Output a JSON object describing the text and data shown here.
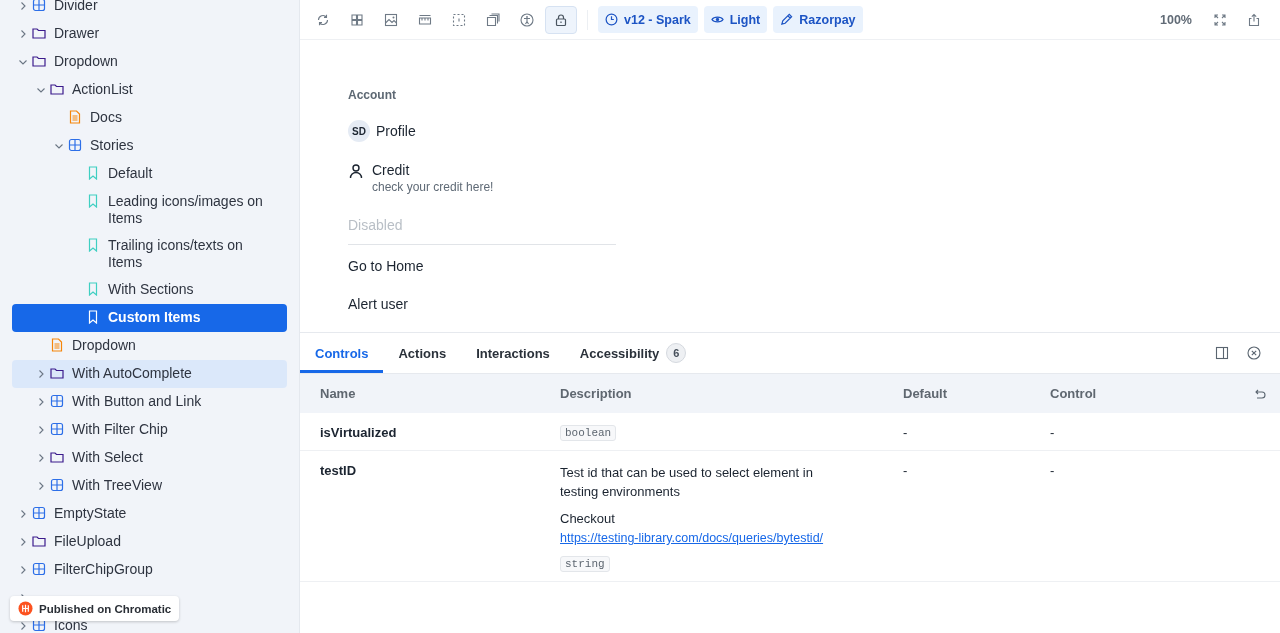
{
  "sidebar": {
    "tree": [
      {
        "kind": "component",
        "label": "Divider",
        "expanded": false,
        "selected": false,
        "hovered": false
      },
      {
        "kind": "folder",
        "label": "Drawer",
        "expanded": false,
        "selected": false,
        "hovered": false
      },
      {
        "kind": "folder",
        "label": "Dropdown",
        "expanded": true,
        "selected": false,
        "hovered": false,
        "children": [
          {
            "kind": "folder",
            "label": "ActionList",
            "expanded": true,
            "selected": false,
            "hovered": false,
            "children": [
              {
                "kind": "docs",
                "label": "Docs",
                "selected": false,
                "hovered": false
              },
              {
                "kind": "component",
                "label": "Stories",
                "expanded": true,
                "selected": false,
                "hovered": false,
                "children": [
                  {
                    "kind": "story",
                    "label": "Default",
                    "selected": false,
                    "hovered": false
                  },
                  {
                    "kind": "story",
                    "label": "Leading icons/images on Items",
                    "selected": false,
                    "hovered": false
                  },
                  {
                    "kind": "story",
                    "label": "Trailing icons/texts on Items",
                    "selected": false,
                    "hovered": false
                  },
                  {
                    "kind": "story",
                    "label": "With Sections",
                    "selected": false,
                    "hovered": false
                  },
                  {
                    "kind": "story",
                    "label": "Custom Items",
                    "selected": true,
                    "hovered": false
                  }
                ]
              }
            ]
          },
          {
            "kind": "docs",
            "label": "Dropdown",
            "selected": false,
            "hovered": false
          },
          {
            "kind": "folder",
            "label": "With AutoComplete",
            "expanded": false,
            "selected": false,
            "hovered": true
          },
          {
            "kind": "component",
            "label": "With Button and Link",
            "expanded": false,
            "selected": false,
            "hovered": false
          },
          {
            "kind": "component",
            "label": "With Filter Chip",
            "expanded": false,
            "selected": false,
            "hovered": false
          },
          {
            "kind": "folder",
            "label": "With Select",
            "expanded": false,
            "selected": false,
            "hovered": false
          },
          {
            "kind": "component",
            "label": "With TreeView",
            "expanded": false,
            "selected": false,
            "hovered": false
          }
        ]
      },
      {
        "kind": "component",
        "label": "EmptyState",
        "expanded": false,
        "selected": false,
        "hovered": false
      },
      {
        "kind": "folder",
        "label": "FileUpload",
        "expanded": false,
        "selected": false,
        "hovered": false
      },
      {
        "kind": "component",
        "label": "FilterChipGroup",
        "expanded": false,
        "selected": false,
        "hovered": false
      },
      {
        "expanded": false,
        "selected": false,
        "hovered": false
      },
      {
        "kind": "component",
        "label": "Icons",
        "expanded": false,
        "selected": false,
        "hovered": false
      }
    ],
    "publish_badge": {
      "label": "Published on Chromatic"
    }
  },
  "toolbar": {
    "tools": [
      {
        "kind": "reload",
        "selected": false
      },
      {
        "kind": "grid",
        "selected": false
      },
      {
        "kind": "image",
        "selected": false
      },
      {
        "kind": "ruler",
        "selected": false
      },
      {
        "kind": "outline",
        "selected": false
      },
      {
        "kind": "layers",
        "selected": false
      },
      {
        "kind": "accessibility",
        "selected": false
      },
      {
        "kind": "lock",
        "selected": true
      }
    ],
    "chips": [
      {
        "kind": "version",
        "label": "v12 - Spark"
      },
      {
        "kind": "theme",
        "label": "Light"
      },
      {
        "kind": "brand",
        "label": "Razorpay"
      }
    ],
    "zoom": "100%"
  },
  "preview": {
    "section_title": "Account",
    "items": [
      {
        "kind": "avatar",
        "initials": "SD",
        "label": "Profile",
        "disabled": false
      },
      {
        "kind": "icon",
        "label": "Credit",
        "description": "check your credit here!",
        "disabled": false
      },
      {
        "kind": "plain",
        "label": "Disabled",
        "disabled": true
      },
      {
        "kind": "divider"
      },
      {
        "kind": "plain",
        "label": "Go to Home",
        "disabled": false
      },
      {
        "kind": "plain",
        "label": "Alert user",
        "disabled": false
      }
    ]
  },
  "addons": {
    "tabs": [
      {
        "label": "Controls",
        "selected": true
      },
      {
        "label": "Actions",
        "selected": false
      },
      {
        "label": "Interactions",
        "selected": false
      },
      {
        "label": "Accessibility",
        "selected": false,
        "count": "6"
      }
    ],
    "table": {
      "columns": [
        "Name",
        "Description",
        "Default",
        "Control"
      ],
      "rows": [
        {
          "name": "isVirtualized",
          "type": "boolean",
          "default": "-",
          "control": "-"
        },
        {
          "name": "testID",
          "text": "Test id that can be used to select element in testing environments",
          "prefix": "Checkout",
          "link": "https://testing-library.com/docs/queries/bytestid/",
          "type": "string",
          "default": "-",
          "control": "-"
        }
      ]
    }
  }
}
